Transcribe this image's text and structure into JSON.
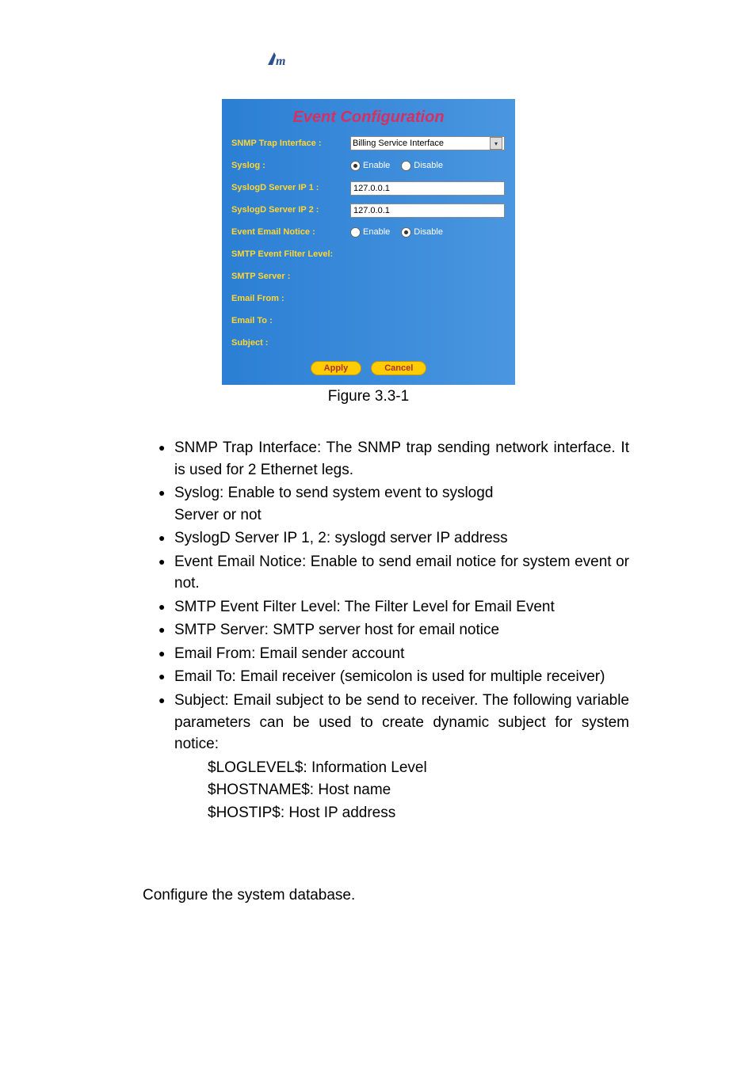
{
  "panel": {
    "title": "Event Configuration",
    "rows": {
      "snmp_trap_interface_label": "SNMP Trap Interface :",
      "snmp_trap_interface_value": "Billing Service Interface",
      "syslog_label": "Syslog :",
      "syslogd_server_ip1_label": "SyslogD Server IP 1 :",
      "syslogd_server_ip1_value": "127.0.0.1",
      "syslogd_server_ip2_label": "SyslogD Server IP 2 :",
      "syslogd_server_ip2_value": "127.0.0.1",
      "event_email_notice_label": "Event Email Notice :",
      "smtp_event_filter_label": "SMTP Event Filter Level:",
      "smtp_server_label": "SMTP Server :",
      "email_from_label": "Email From :",
      "email_to_label": "Email To :",
      "subject_label": "Subject :"
    },
    "radio": {
      "enable": "Enable",
      "disable": "Disable"
    },
    "buttons": {
      "apply": "Apply",
      "cancel": "Cancel"
    }
  },
  "caption": "Figure 3.3-1",
  "bullets": {
    "b1": "SNMP Trap Interface: The SNMP trap sending network interface. It is used for 2 Ethernet legs.",
    "b2a": "Syslog: Enable to send system event to syslogd",
    "b2b": "Server or not",
    "b3": "SyslogD Server IP 1, 2: syslogd server IP address",
    "b4": "Event Email Notice: Enable to send email notice for system event or not.",
    "b5": "SMTP Event Filter Level: The Filter Level for Email Event",
    "b6": "SMTP Server: SMTP server host for email notice",
    "b7": "Email From: Email sender account",
    "b8": "Email To: Email receiver (semicolon is used for multiple receiver)",
    "b9": "Subject: Email subject to be send to receiver. The following variable parameters can be used to create dynamic subject for system notice:",
    "s1": "$LOGLEVEL$: Information Level",
    "s2": "$HOSTNAME$: Host name",
    "s3": "$HOSTIP$: Host IP address"
  },
  "after": "Configure the system database."
}
